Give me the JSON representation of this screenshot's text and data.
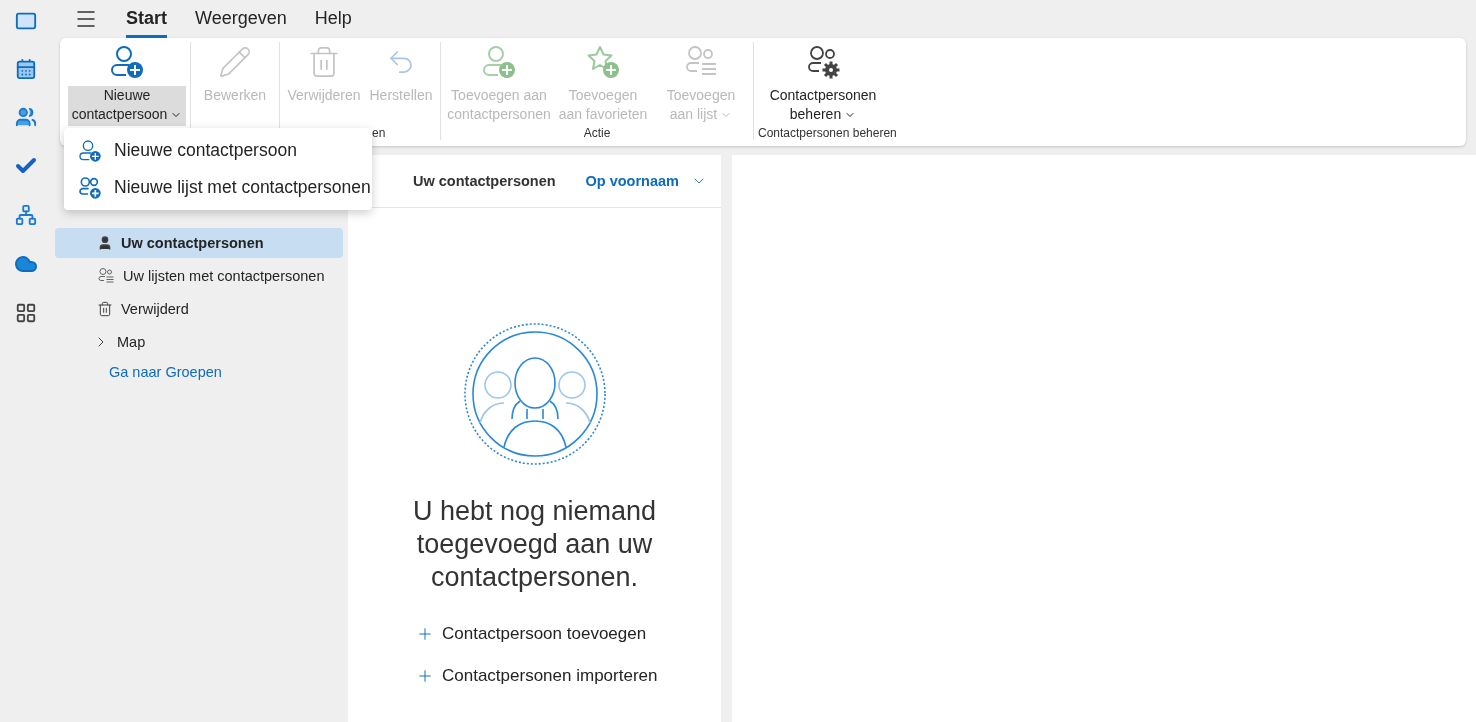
{
  "menu_tabs": [
    {
      "label": "Start",
      "selected": true
    },
    {
      "label": "Weergeven",
      "selected": false
    },
    {
      "label": "Help",
      "selected": false
    }
  ],
  "ribbon": {
    "groups": [
      {
        "buttons": [
          {
            "kind": "new-contact",
            "label": "Nieuwe contactpersoon",
            "disabled": false,
            "dropdown": true,
            "expanded": true
          }
        ]
      },
      {
        "buttons": [
          {
            "kind": "edit",
            "label": "Bewerken",
            "disabled": true,
            "dropdown": false,
            "expanded": false
          }
        ]
      },
      {
        "label": "en",
        "buttons": [
          {
            "kind": "delete",
            "label": "Verwijderen",
            "disabled": true,
            "dropdown": false,
            "expanded": false
          },
          {
            "kind": "restore",
            "label": "Herstellen",
            "disabled": true,
            "dropdown": false,
            "expanded": false
          }
        ]
      },
      {
        "label": "Actie",
        "buttons": [
          {
            "kind": "add-contact",
            "label": "Toevoegen aan contactpersonen",
            "disabled": true,
            "dropdown": false,
            "expanded": false
          },
          {
            "kind": "add-favorite",
            "label": "Toevoegen aan favorieten",
            "disabled": true,
            "dropdown": false,
            "expanded": false
          },
          {
            "kind": "add-list",
            "label": "Toevoegen aan lijst",
            "disabled": true,
            "dropdown": true,
            "expanded": false
          }
        ]
      },
      {
        "label": "Contactpersonen beheren",
        "buttons": [
          {
            "kind": "manage",
            "label": "Contactpersonen beheren",
            "disabled": false,
            "dropdown": true,
            "expanded": false
          }
        ]
      }
    ]
  },
  "dropdown_menu": {
    "items": [
      {
        "kind": "contact",
        "label": "Nieuwe contactpersoon"
      },
      {
        "kind": "list",
        "label": "Nieuwe lijst met contactpersonen"
      }
    ]
  },
  "sidebar": {
    "items": [
      {
        "kind": "contacts",
        "label": "Uw contactpersonen",
        "selected": true
      },
      {
        "kind": "lists",
        "label": "Uw lijsten met contactpersonen",
        "selected": false
      },
      {
        "kind": "deleted",
        "label": "Verwijderd",
        "selected": false
      },
      {
        "kind": "folder",
        "label": "Map",
        "selected": false
      },
      {
        "kind": "link",
        "label": "Ga naar Groepen"
      }
    ]
  },
  "contact_list": {
    "title": "Uw contactpersonen",
    "sort": "Op voornaam",
    "empty_message": "U hebt nog niemand toegevoegd aan uw contactpersonen.",
    "actions": [
      "Contactpersoon toevoegen",
      "Contactpersonen importeren"
    ]
  }
}
